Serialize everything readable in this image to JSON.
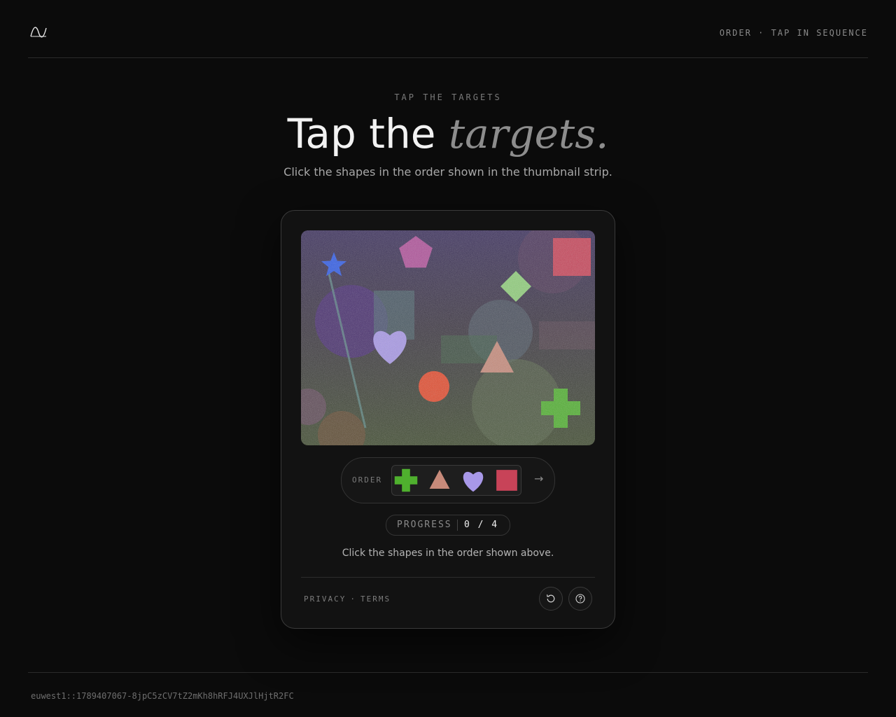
{
  "header": {
    "tagline": "ORDER · TAP IN SEQUENCE",
    "logo_icon": "wave-logo-icon"
  },
  "hero": {
    "eyebrow": "TAP THE TARGETS",
    "headline_main": "Tap the ",
    "headline_accent": "targets.",
    "subtitle": "Click the shapes in the order shown in the thumbnail strip."
  },
  "challenge": {
    "shapes": [
      {
        "name": "star",
        "color": "#2f5be8"
      },
      {
        "name": "pentagon",
        "color": "#b0509a"
      },
      {
        "name": "square",
        "color": "#c84358"
      },
      {
        "name": "diamond",
        "color": "#8fcf7a"
      },
      {
        "name": "heart",
        "color": "#a898e8"
      },
      {
        "name": "triangle",
        "color": "#c78a7a"
      },
      {
        "name": "circle",
        "color": "#e44a2c"
      },
      {
        "name": "cross",
        "color": "#4fb02e"
      }
    ],
    "order_label": "ORDER",
    "order_sequence": [
      {
        "name": "cross",
        "color": "#4fb02e"
      },
      {
        "name": "triangle",
        "color": "#c78a7a"
      },
      {
        "name": "heart",
        "color": "#a898e8"
      },
      {
        "name": "square",
        "color": "#c84358"
      }
    ],
    "order_arrow": "→",
    "progress_label": "PROGRESS",
    "progress_value": "0 / 4",
    "progress_current": 0,
    "progress_total": 4,
    "instruction": "Click the shapes in the order shown above."
  },
  "footer_links": {
    "privacy": "PRIVACY",
    "separator": "·",
    "terms": "TERMS"
  },
  "actions": {
    "refresh_icon": "refresh-icon",
    "help_icon": "help-icon"
  },
  "session_id": "euwest1::1789407067-8jpC5zCV7tZ2mKh8hRFJ4UXJlHjtR2FC"
}
